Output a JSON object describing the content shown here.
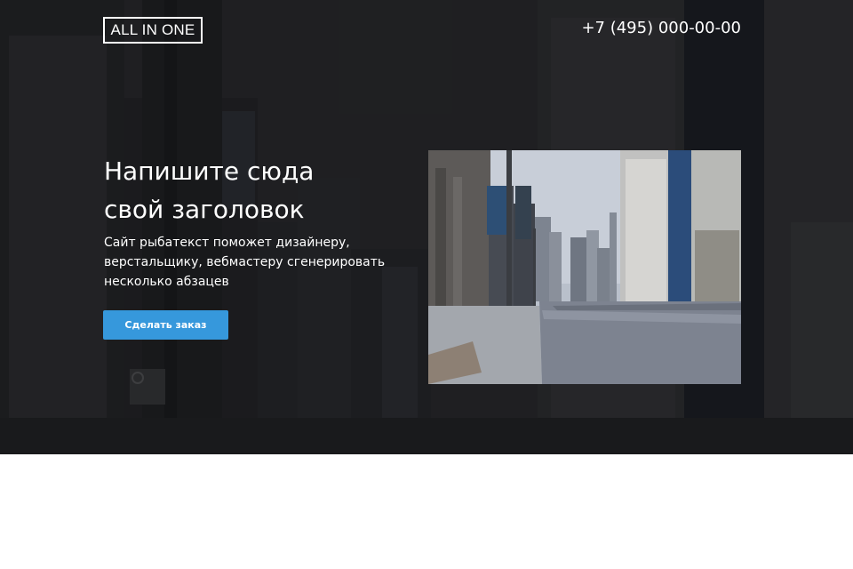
{
  "header": {
    "logo_text": "ALL IN ONE",
    "phone": "+7 (495) 000-00-00"
  },
  "hero": {
    "headline_line1": "Напишите сюда",
    "headline_line2": "свой заголовок",
    "subtext_line1": "Сайт рыбатекст поможет дизайнеру,",
    "subtext_line2": "верстальщику, вебмастеру сгенерировать",
    "subtext_line3": "несколько абзацев",
    "cta_label": "Сделать заказ"
  },
  "colors": {
    "accent": "#3698dc",
    "text": "#ffffff",
    "hero_overlay": "#1f2022",
    "page_background": "#ffffff"
  }
}
